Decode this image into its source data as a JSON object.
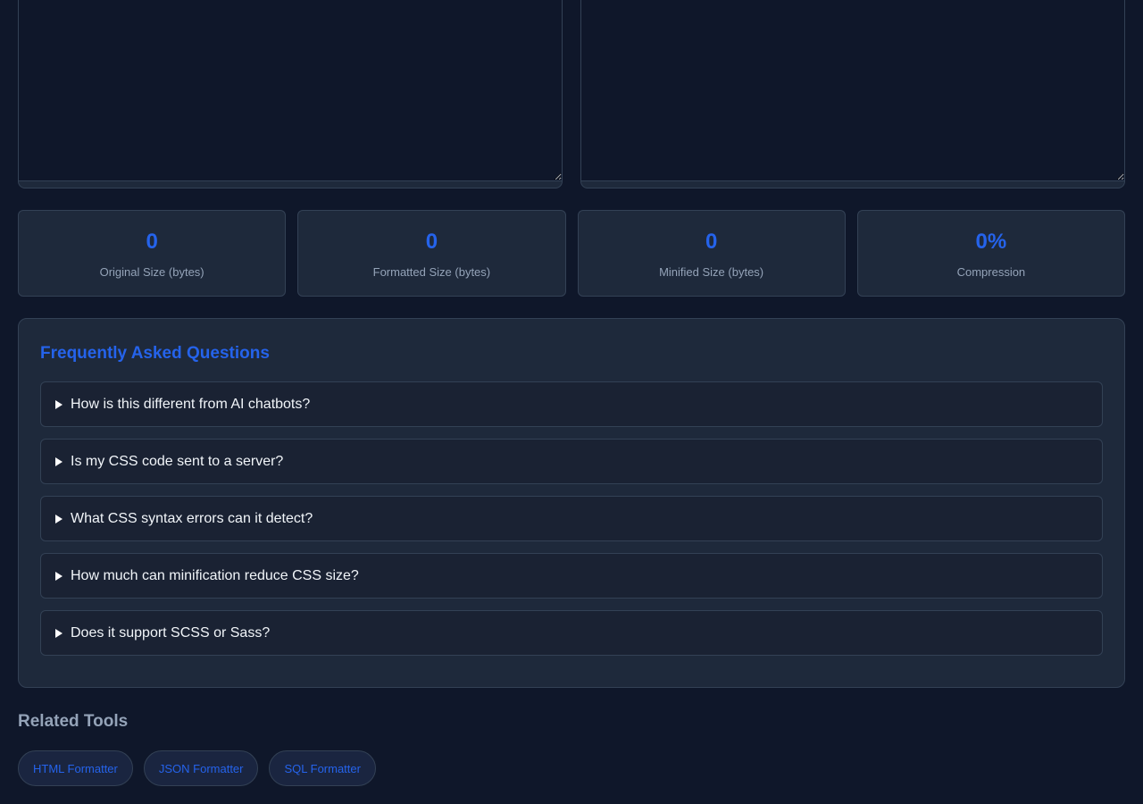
{
  "editors": {
    "input_value": "",
    "output_value": ""
  },
  "stats": [
    {
      "value": "0",
      "label": "Original Size (bytes)"
    },
    {
      "value": "0",
      "label": "Formatted Size (bytes)"
    },
    {
      "value": "0",
      "label": "Minified Size (bytes)"
    },
    {
      "value": "0%",
      "label": "Compression"
    }
  ],
  "faq": {
    "title": "Frequently Asked Questions",
    "items": [
      {
        "question": "How is this different from AI chatbots?"
      },
      {
        "question": "Is my CSS code sent to a server?"
      },
      {
        "question": "What CSS syntax errors can it detect?"
      },
      {
        "question": "How much can minification reduce CSS size?"
      },
      {
        "question": "Does it support SCSS or Sass?"
      }
    ]
  },
  "related": {
    "title": "Related Tools",
    "tools": [
      {
        "label": "HTML Formatter"
      },
      {
        "label": "JSON Formatter"
      },
      {
        "label": "SQL Formatter"
      }
    ]
  },
  "colors": {
    "background": "#0f172a",
    "panel": "#1e293b",
    "accent": "#2563eb",
    "muted": "#94a3b8"
  },
  "icons": {
    "faq_arrow": "triangle-right-icon"
  }
}
